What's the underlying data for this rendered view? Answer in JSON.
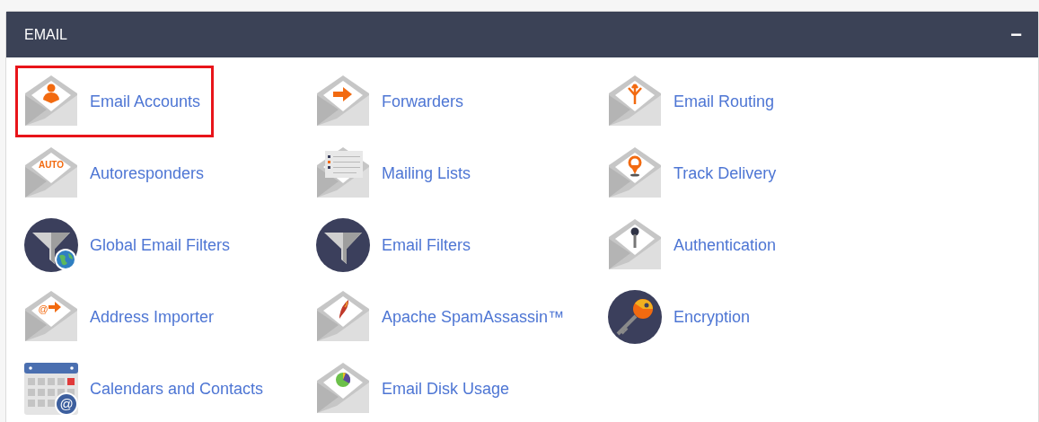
{
  "panel": {
    "title": "EMAIL",
    "collapse_symbol": "−",
    "expanded": true
  },
  "items": [
    {
      "label": "Email Accounts",
      "kind": "person",
      "highlighted": true
    },
    {
      "label": "Forwarders",
      "kind": "arrow",
      "highlighted": false
    },
    {
      "label": "Email Routing",
      "kind": "routing",
      "highlighted": false
    },
    {
      "label": "Autoresponders",
      "kind": "auto",
      "icon_text": "AUTO",
      "highlighted": false
    },
    {
      "label": "Mailing Lists",
      "kind": "list",
      "highlighted": false
    },
    {
      "label": "Track Delivery",
      "kind": "pin",
      "highlighted": false
    },
    {
      "label": "Global Email Filters",
      "kind": "funnel-globe",
      "highlighted": false
    },
    {
      "label": "Email Filters",
      "kind": "funnel",
      "highlighted": false
    },
    {
      "label": "Authentication",
      "kind": "key",
      "highlighted": false
    },
    {
      "label": "Address Importer",
      "kind": "import",
      "icon_text": "@",
      "highlighted": false
    },
    {
      "label": "Apache SpamAssassin™",
      "kind": "feather",
      "highlighted": false
    },
    {
      "label": "Encryption",
      "kind": "round-key",
      "highlighted": false
    },
    {
      "label": "Calendars and Contacts",
      "kind": "calendar",
      "icon_text": "@",
      "highlighted": false
    },
    {
      "label": "Email Disk Usage",
      "kind": "pie",
      "highlighted": false
    }
  ]
}
